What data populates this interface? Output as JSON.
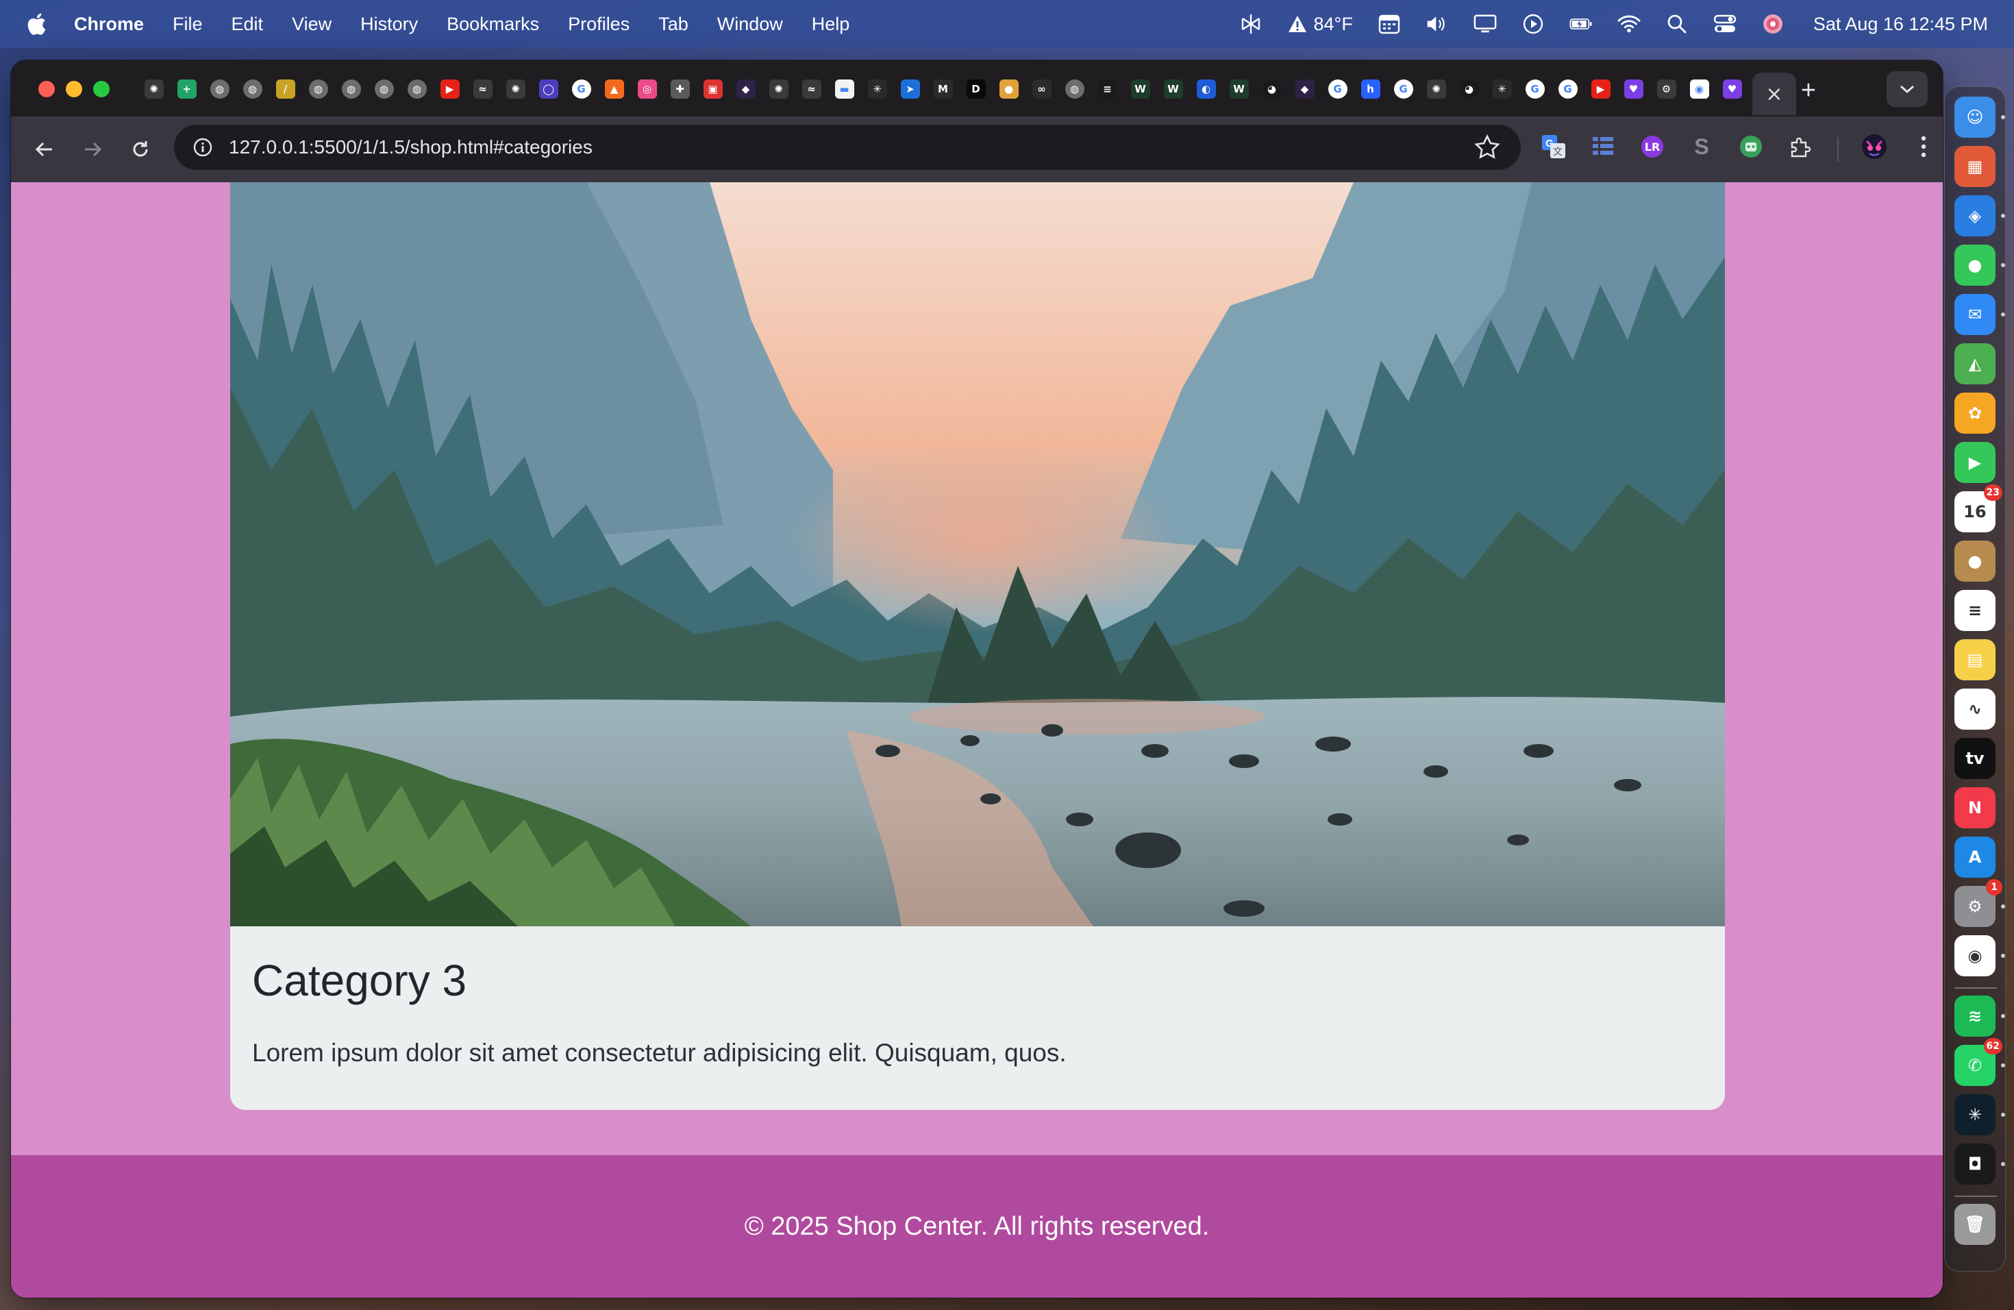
{
  "menubar": {
    "app_name": "Chrome",
    "menus": [
      "File",
      "Edit",
      "View",
      "History",
      "Bookmarks",
      "Profiles",
      "Tab",
      "Window",
      "Help"
    ],
    "weather": "84°F",
    "datetime": "Sat Aug 16  12:45 PM"
  },
  "browser": {
    "tab_favicons": [
      {
        "icon": "openai-icon",
        "color": "#3a3a3a",
        "glyph": "✺"
      },
      {
        "icon": "sheets-plus-icon",
        "color": "#21a366",
        "glyph": "+"
      },
      {
        "icon": "globe-icon",
        "color": "#6d6d6d",
        "glyph": "◍"
      },
      {
        "icon": "globe-icon",
        "color": "#6d6d6d",
        "glyph": "◍"
      },
      {
        "icon": "stripes-icon",
        "color": "#c9a227",
        "glyph": "/"
      },
      {
        "icon": "globe-icon",
        "color": "#6d6d6d",
        "glyph": "◍"
      },
      {
        "icon": "globe-icon",
        "color": "#6d6d6d",
        "glyph": "◍"
      },
      {
        "icon": "globe-icon",
        "color": "#6d6d6d",
        "glyph": "◍"
      },
      {
        "icon": "globe-icon",
        "color": "#6d6d6d",
        "glyph": "◍"
      },
      {
        "icon": "youtube-icon",
        "color": "#e62117",
        "glyph": "▶"
      },
      {
        "icon": "wind-icon",
        "color": "#3a3a3a",
        "glyph": "≈"
      },
      {
        "icon": "openai-icon",
        "color": "#3a3a3a",
        "glyph": "✺"
      },
      {
        "icon": "ring-icon",
        "color": "#4b3fbf",
        "glyph": "◯"
      },
      {
        "icon": "google-icon",
        "color": "#ffffff",
        "glyph": "G"
      },
      {
        "icon": "fire-icon",
        "color": "#f26b1d",
        "glyph": "▲"
      },
      {
        "icon": "dribbble-icon",
        "color": "#ea4c89",
        "glyph": "◎"
      },
      {
        "icon": "puzzle-icon",
        "color": "#5a5a5a",
        "glyph": "✚"
      },
      {
        "icon": "image-icon",
        "color": "#d33",
        "glyph": "▣"
      },
      {
        "icon": "mask-icon",
        "color": "#2c2346",
        "glyph": "◆"
      },
      {
        "icon": "openai-icon",
        "color": "#3a3a3a",
        "glyph": "✺"
      },
      {
        "icon": "wind-icon",
        "color": "#3a3a3a",
        "glyph": "≈"
      },
      {
        "icon": "messenger-icon",
        "color": "#f3f3f3",
        "glyph": "▬"
      },
      {
        "icon": "perplexity-icon",
        "color": "#2b2b2b",
        "glyph": "✳"
      },
      {
        "icon": "kite-icon",
        "color": "#1e6fd9",
        "glyph": "➤"
      },
      {
        "icon": "m-logo-icon",
        "color": "#2b2b2b",
        "glyph": "M"
      },
      {
        "icon": "dev-icon",
        "color": "#0a0a0a",
        "glyph": "D"
      },
      {
        "icon": "figure-icon",
        "color": "#e0a23a",
        "glyph": "●"
      },
      {
        "icon": "infinity-icon",
        "color": "#2b2b2b",
        "glyph": "∞"
      },
      {
        "icon": "globe-icon",
        "color": "#6d6d6d",
        "glyph": "◍"
      },
      {
        "icon": "layers-icon",
        "color": "#1b1b1b",
        "glyph": "≡"
      },
      {
        "icon": "w-logo-icon",
        "color": "#1f3d2b",
        "glyph": "W"
      },
      {
        "icon": "w-logo-icon",
        "color": "#1f3d2b",
        "glyph": "W"
      },
      {
        "icon": "circle-blue-icon",
        "color": "#1f5bd6",
        "glyph": "◐"
      },
      {
        "icon": "w-logo-icon",
        "color": "#1f3d2b",
        "glyph": "W"
      },
      {
        "icon": "github-icon",
        "color": "#1a1a1a",
        "glyph": "◕"
      },
      {
        "icon": "mask-icon",
        "color": "#2c2346",
        "glyph": "◆"
      },
      {
        "icon": "google-icon",
        "color": "#ffffff",
        "glyph": "G"
      },
      {
        "icon": "hashnode-icon",
        "color": "#2962ff",
        "glyph": "h"
      },
      {
        "icon": "google-icon",
        "color": "#ffffff",
        "glyph": "G"
      },
      {
        "icon": "openai-icon",
        "color": "#3a3a3a",
        "glyph": "✺"
      },
      {
        "icon": "github-icon",
        "color": "#1a1a1a",
        "glyph": "◕"
      },
      {
        "icon": "perplexity-icon",
        "color": "#2b2b2b",
        "glyph": "✳"
      },
      {
        "icon": "google-icon",
        "color": "#ffffff",
        "glyph": "G"
      },
      {
        "icon": "google-icon",
        "color": "#ffffff",
        "glyph": "G"
      },
      {
        "icon": "youtube-icon",
        "color": "#e62117",
        "glyph": "▶"
      },
      {
        "icon": "heart-chat-icon",
        "color": "#7b3fe4",
        "glyph": "♥"
      },
      {
        "icon": "gear-icon",
        "color": "#3a3a3a",
        "glyph": "⚙"
      },
      {
        "icon": "duo-icon",
        "color": "#ffffff",
        "glyph": "◉"
      },
      {
        "icon": "heart-chat-icon",
        "color": "#7b3fe4",
        "glyph": "♥"
      }
    ],
    "active_tab_close": "×",
    "new_tab": "+",
    "url": "127.0.0.1:5500/1/1.5/shop.html#categories",
    "accent": "#3a3640"
  },
  "page": {
    "card": {
      "title": "Category 3",
      "description": "Lorem ipsum dolor sit amet consectetur adipisicing elit. Quisquam, quos."
    },
    "footer": {
      "text": "© 2025 Shop Center. All rights reserved."
    },
    "colors": {
      "page_bg": "#d78ecb",
      "footer_bg": "#b04a9e",
      "card_bg": "#ecefef"
    }
  },
  "dock": {
    "items": [
      {
        "name": "finder-icon",
        "color": "#3b8ee8",
        "glyph": "☺"
      },
      {
        "name": "launchpad-icon",
        "color": "#e05a3a",
        "glyph": "▦"
      },
      {
        "name": "safari-icon",
        "color": "#2a7de1",
        "glyph": "◈"
      },
      {
        "name": "messages-icon",
        "color": "#34c759",
        "glyph": "●"
      },
      {
        "name": "mail-icon",
        "color": "#2f8af5",
        "glyph": "✉"
      },
      {
        "name": "maps-icon",
        "color": "#4caf50",
        "glyph": "◭"
      },
      {
        "name": "photos-icon",
        "color": "#f5a623",
        "glyph": "✿"
      },
      {
        "name": "facetime-icon",
        "color": "#34c759",
        "glyph": "▶"
      },
      {
        "name": "calendar-icon",
        "color": "#ffffff",
        "glyph": "16",
        "badge": "23"
      },
      {
        "name": "contacts-icon",
        "color": "#b78a4f",
        "glyph": "●"
      },
      {
        "name": "reminders-icon",
        "color": "#ffffff",
        "glyph": "≡"
      },
      {
        "name": "notes-icon",
        "color": "#f7d04a",
        "glyph": "▤"
      },
      {
        "name": "freeform-icon",
        "color": "#ffffff",
        "glyph": "∿"
      },
      {
        "name": "apple-tv-icon",
        "color": "#111111",
        "glyph": "tv"
      },
      {
        "name": "news-icon",
        "color": "#f23a4a",
        "glyph": "N"
      },
      {
        "name": "app-store-icon",
        "color": "#1e88e5",
        "glyph": "A"
      },
      {
        "name": "system-settings-icon",
        "color": "#8e8e93",
        "glyph": "⚙",
        "badge": "1"
      },
      {
        "name": "chrome-icon",
        "color": "#ffffff",
        "glyph": "◉"
      },
      {
        "name": "spotify-icon",
        "color": "#1db954",
        "glyph": "≋"
      },
      {
        "name": "whatsapp-icon",
        "color": "#25d366",
        "glyph": "✆",
        "badge": "62"
      },
      {
        "name": "perplexity-dock-icon",
        "color": "#0f1f2b",
        "glyph": "✳"
      },
      {
        "name": "box-app-icon",
        "color": "#1a1a1a",
        "glyph": "◘"
      },
      {
        "name": "trash-icon",
        "color": "#9a9a9a",
        "glyph": "🗑"
      }
    ]
  }
}
